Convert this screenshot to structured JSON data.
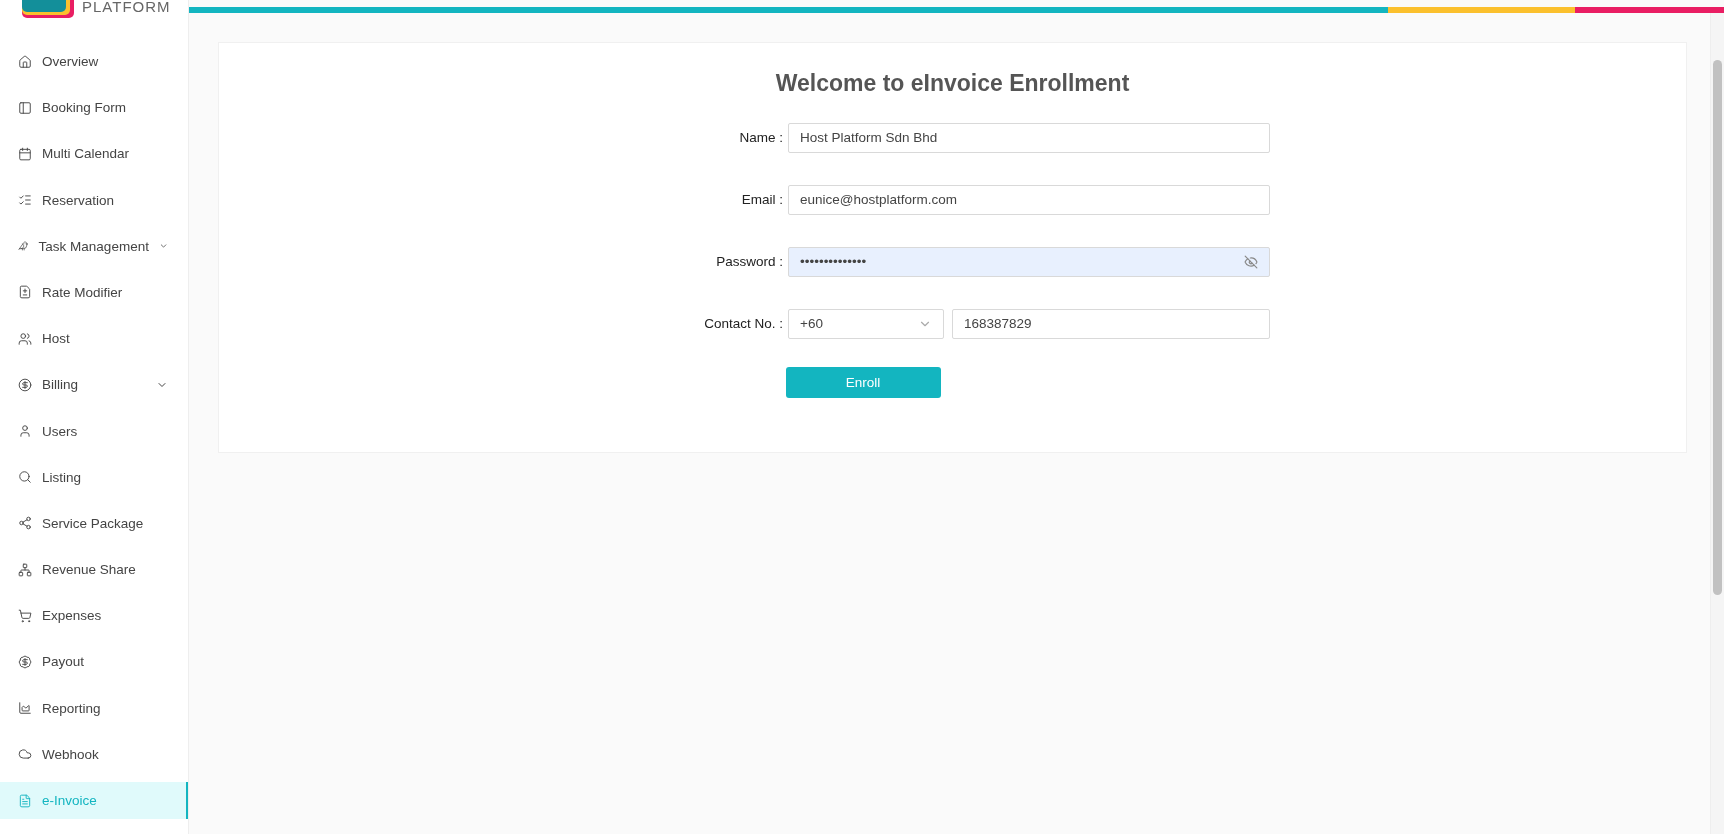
{
  "logo": {
    "text": "PLATFORM"
  },
  "sidebar": {
    "items": [
      {
        "label": "Overview",
        "selected": false
      },
      {
        "label": "Booking Form",
        "selected": false
      },
      {
        "label": "Multi Calendar",
        "selected": false
      },
      {
        "label": "Reservation",
        "selected": false
      },
      {
        "label": "Task Management",
        "selected": false,
        "expanded": false
      },
      {
        "label": "Rate Modifier",
        "selected": false
      },
      {
        "label": "Host",
        "selected": false
      },
      {
        "label": "Billing",
        "selected": false,
        "expanded": false
      },
      {
        "label": "Users",
        "selected": false
      },
      {
        "label": "Listing",
        "selected": false
      },
      {
        "label": "Service Package",
        "selected": false
      },
      {
        "label": "Revenue Share",
        "selected": false
      },
      {
        "label": "Expenses",
        "selected": false
      },
      {
        "label": "Payout",
        "selected": false
      },
      {
        "label": "Reporting",
        "selected": false
      },
      {
        "label": "Webhook",
        "selected": false
      },
      {
        "label": "e-Invoice",
        "selected": true
      }
    ]
  },
  "form": {
    "title": "Welcome to eInvoice Enrollment",
    "fields": [
      {
        "kind": "text",
        "label": "Name :",
        "value": "Host Platform Sdn Bhd"
      },
      {
        "kind": "text",
        "label": "Email :",
        "value": "eunice@hostplatform.com"
      },
      {
        "kind": "password",
        "label": "Password :",
        "value": "••••••••••••••",
        "autofilled": true
      },
      {
        "kind": "phone",
        "label": "Contact No. :",
        "code": "+60",
        "value": "168387829"
      }
    ],
    "submit": "Enroll"
  }
}
